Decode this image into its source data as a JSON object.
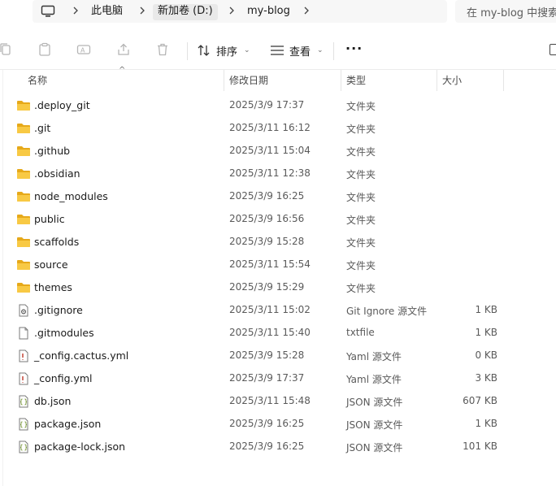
{
  "breadcrumb": {
    "items": [
      {
        "label": "此电脑"
      },
      {
        "label": "新加卷 (D:)"
      },
      {
        "label": "my-blog"
      }
    ]
  },
  "search": {
    "placeholder": "在 my-blog 中搜索"
  },
  "toolbar": {
    "sort_label": "排序",
    "view_label": "查看",
    "more_label": "···"
  },
  "columns": {
    "name": "名称",
    "date": "修改日期",
    "type": "类型",
    "size": "大小"
  },
  "colors": {
    "folder": "#f8c944",
    "folder_dark": "#e6a91a",
    "selected_crumb": "#e9e9e9"
  },
  "files": [
    {
      "name": ".deploy_git",
      "date": "2025/3/9 17:37",
      "type": "文件夹",
      "size": "",
      "icon": "folder-icon"
    },
    {
      "name": ".git",
      "date": "2025/3/11 16:12",
      "type": "文件夹",
      "size": "",
      "icon": "folder-icon"
    },
    {
      "name": ".github",
      "date": "2025/3/11 15:04",
      "type": "文件夹",
      "size": "",
      "icon": "folder-icon"
    },
    {
      "name": ".obsidian",
      "date": "2025/3/11 12:38",
      "type": "文件夹",
      "size": "",
      "icon": "folder-icon"
    },
    {
      "name": "node_modules",
      "date": "2025/3/9 16:25",
      "type": "文件夹",
      "size": "",
      "icon": "folder-icon"
    },
    {
      "name": "public",
      "date": "2025/3/9 16:56",
      "type": "文件夹",
      "size": "",
      "icon": "folder-icon"
    },
    {
      "name": "scaffolds",
      "date": "2025/3/9 15:28",
      "type": "文件夹",
      "size": "",
      "icon": "folder-icon"
    },
    {
      "name": "source",
      "date": "2025/3/11 15:54",
      "type": "文件夹",
      "size": "",
      "icon": "folder-icon"
    },
    {
      "name": "themes",
      "date": "2025/3/9 15:29",
      "type": "文件夹",
      "size": "",
      "icon": "folder-icon"
    },
    {
      "name": ".gitignore",
      "date": "2025/3/11 15:02",
      "type": "Git Ignore 源文件",
      "size": "1 KB",
      "icon": "gear-file-icon"
    },
    {
      "name": ".gitmodules",
      "date": "2025/3/11 15:40",
      "type": "txtfile",
      "size": "1 KB",
      "icon": "blank-file-icon"
    },
    {
      "name": "_config.cactus.yml",
      "date": "2025/3/9 15:28",
      "type": "Yaml 源文件",
      "size": "0 KB",
      "icon": "yaml-file-icon"
    },
    {
      "name": "_config.yml",
      "date": "2025/3/9 17:37",
      "type": "Yaml 源文件",
      "size": "3 KB",
      "icon": "yaml-file-icon"
    },
    {
      "name": "db.json",
      "date": "2025/3/11 15:48",
      "type": "JSON 源文件",
      "size": "607 KB",
      "icon": "json-file-icon"
    },
    {
      "name": "package.json",
      "date": "2025/3/9 16:25",
      "type": "JSON 源文件",
      "size": "1 KB",
      "icon": "json-file-icon"
    },
    {
      "name": "package-lock.json",
      "date": "2025/3/9 16:25",
      "type": "JSON 源文件",
      "size": "101 KB",
      "icon": "json-file-icon"
    }
  ]
}
